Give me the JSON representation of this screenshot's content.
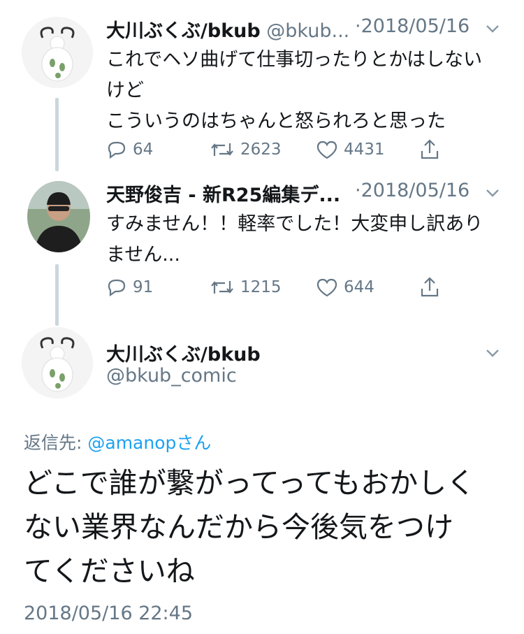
{
  "tweets": [
    {
      "name": "大川ぶくぶ/bkub",
      "handle": "@bkub...",
      "date": "·2018/05/16",
      "text": "これでヘソ曲げて仕事切ったりとかはしない\nけど\nこういうのはちゃんと怒られろと思った",
      "replies": "64",
      "retweets": "2623",
      "likes": "4431"
    },
    {
      "name": "天野俊吉 - 新R25編集デ...",
      "handle": "",
      "date": "·2018/05/16",
      "text": "すみません！！軽率でした！大変申し訳あり\nません...",
      "replies": "91",
      "retweets": "1215",
      "likes": "644"
    }
  ],
  "main_tweet": {
    "name": "大川ぶくぶ/bkub",
    "handle": "@bkub_comic",
    "reply_label": "返信先: ",
    "reply_mention": "@amanop",
    "reply_suffix": "さん",
    "text": "どこで誰が繋がってってもおかしく\nない業界なんだから今後気をつけ\nてくださいね",
    "timestamp": "2018/05/16 22:45"
  },
  "colors": {
    "text": "#14171a",
    "secondary": "#657786",
    "link": "#1da1f2",
    "thread_line": "#ccd6dd"
  },
  "icons": [
    "reply-icon",
    "retweet-icon",
    "like-icon",
    "share-icon",
    "chevron-down-icon"
  ]
}
